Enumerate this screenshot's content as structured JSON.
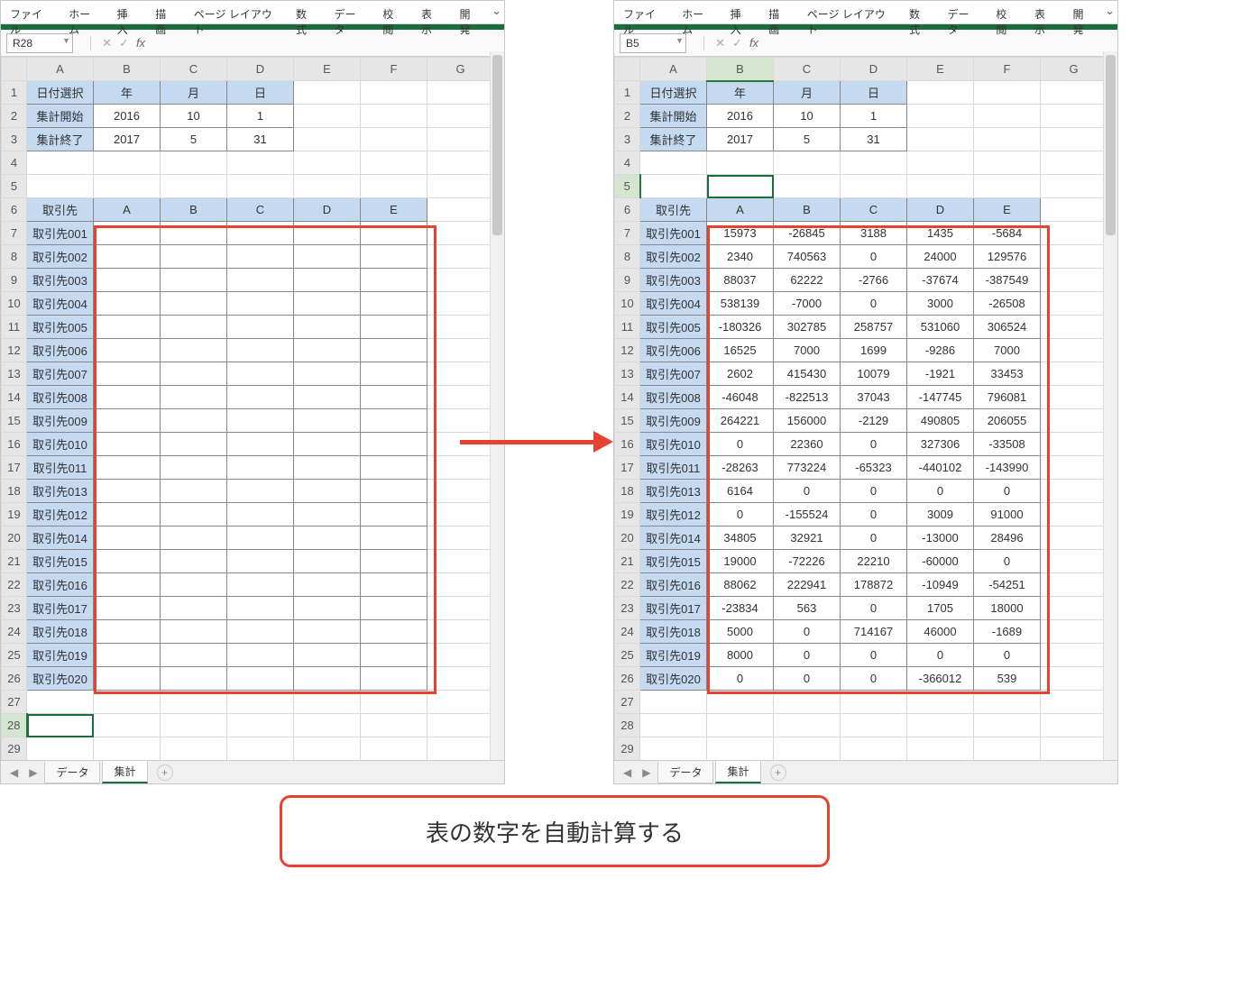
{
  "ribbon": [
    "ファイル",
    "ホーム",
    "挿入",
    "描画",
    "ページ レイアウト",
    "数式",
    "データ",
    "校閲",
    "表示",
    "開発"
  ],
  "left_namebox": "R28",
  "right_namebox": "B5",
  "columns": [
    "A",
    "B",
    "C",
    "D",
    "E",
    "F",
    "G"
  ],
  "header1": [
    "日付選択",
    "年",
    "月",
    "日",
    "",
    "",
    ""
  ],
  "header2": [
    "集計開始",
    "2016",
    "10",
    "1",
    "",
    "",
    ""
  ],
  "header3": [
    "集計終了",
    "2017",
    "5",
    "31",
    "",
    "",
    ""
  ],
  "header6": [
    "取引先",
    "A",
    "B",
    "C",
    "D",
    "E",
    ""
  ],
  "clients": [
    "取引先001",
    "取引先002",
    "取引先003",
    "取引先004",
    "取引先005",
    "取引先006",
    "取引先007",
    "取引先008",
    "取引先009",
    "取引先010",
    "取引先011",
    "取引先013",
    "取引先012",
    "取引先014",
    "取引先015",
    "取引先016",
    "取引先017",
    "取引先018",
    "取引先019",
    "取引先020"
  ],
  "right_data": [
    [
      "15973",
      "-26845",
      "3188",
      "1435",
      "-5684"
    ],
    [
      "2340",
      "740563",
      "0",
      "24000",
      "129576"
    ],
    [
      "88037",
      "62222",
      "-2766",
      "-37674",
      "-387549"
    ],
    [
      "538139",
      "-7000",
      "0",
      "3000",
      "-26508"
    ],
    [
      "-180326",
      "302785",
      "258757",
      "531060",
      "306524"
    ],
    [
      "16525",
      "7000",
      "1699",
      "-9286",
      "7000"
    ],
    [
      "2602",
      "415430",
      "10079",
      "-1921",
      "33453"
    ],
    [
      "-46048",
      "-822513",
      "37043",
      "-147745",
      "796081"
    ],
    [
      "264221",
      "156000",
      "-2129",
      "490805",
      "206055"
    ],
    [
      "0",
      "22360",
      "0",
      "327306",
      "-33508"
    ],
    [
      "-28263",
      "773224",
      "-65323",
      "-440102",
      "-143990"
    ],
    [
      "6164",
      "0",
      "0",
      "0",
      "0"
    ],
    [
      "0",
      "-155524",
      "0",
      "3009",
      "91000"
    ],
    [
      "34805",
      "32921",
      "0",
      "-13000",
      "28496"
    ],
    [
      "19000",
      "-72226",
      "22210",
      "-60000",
      "0"
    ],
    [
      "88062",
      "222941",
      "178872",
      "-10949",
      "-54251"
    ],
    [
      "-23834",
      "563",
      "0",
      "1705",
      "18000"
    ],
    [
      "5000",
      "0",
      "714167",
      "46000",
      "-1689"
    ],
    [
      "8000",
      "0",
      "0",
      "0",
      "0"
    ],
    [
      "0",
      "0",
      "0",
      "-366012",
      "539"
    ]
  ],
  "sheet_tabs": [
    "データ",
    "集計"
  ],
  "caption": "表の数字を自動計算する"
}
